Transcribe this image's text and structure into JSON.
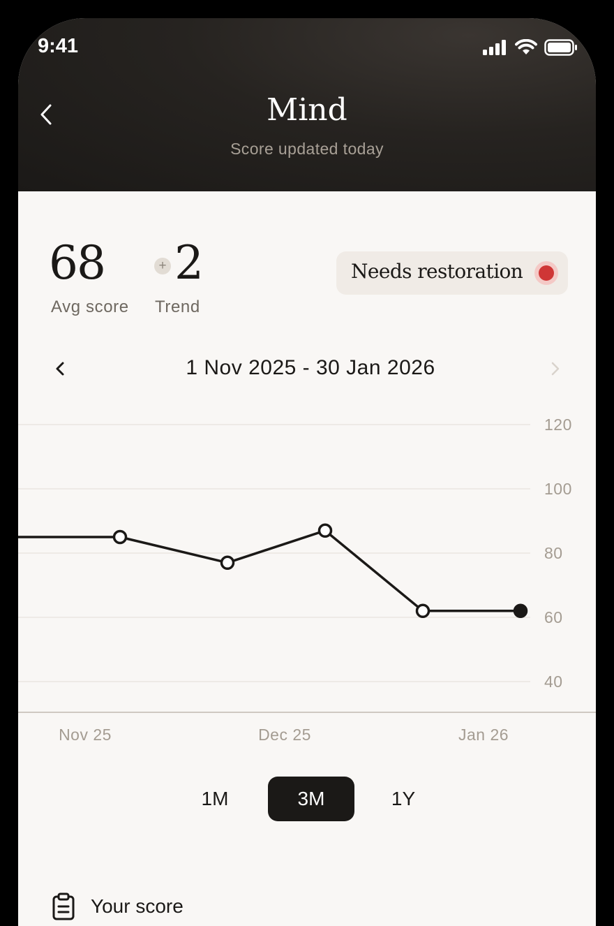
{
  "status_bar": {
    "time": "9:41"
  },
  "header": {
    "title": "Mind",
    "subtitle": "Score updated today"
  },
  "summary": {
    "avg_score": "68",
    "avg_label": "Avg score",
    "trend_sign": "+",
    "trend_value": "2",
    "trend_label": "Trend",
    "status_label": "Needs restoration",
    "status_color": "#cf3636"
  },
  "date_range": {
    "label": "1 Nov 2025 - 30 Jan 2026"
  },
  "chart_data": {
    "type": "line",
    "x": [
      "Nov 2025",
      "mid Nov 2025",
      "early Dec 2025",
      "late Dec 2025",
      "mid Jan 2026",
      "Jan 2026"
    ],
    "series": [
      {
        "values": [
          85,
          85,
          77,
          87,
          62,
          62
        ]
      }
    ],
    "ylim": [
      40,
      120
    ],
    "yticks": [
      "120",
      "100",
      "80",
      "60",
      "40"
    ],
    "xticks": [
      "Nov 25",
      "Dec 25",
      "Jan 26"
    ],
    "grid": true,
    "line_color": "#1b1917"
  },
  "periods": {
    "items": [
      "1M",
      "3M",
      "1Y"
    ],
    "selected": "3M"
  },
  "section": {
    "title": "Your score"
  }
}
